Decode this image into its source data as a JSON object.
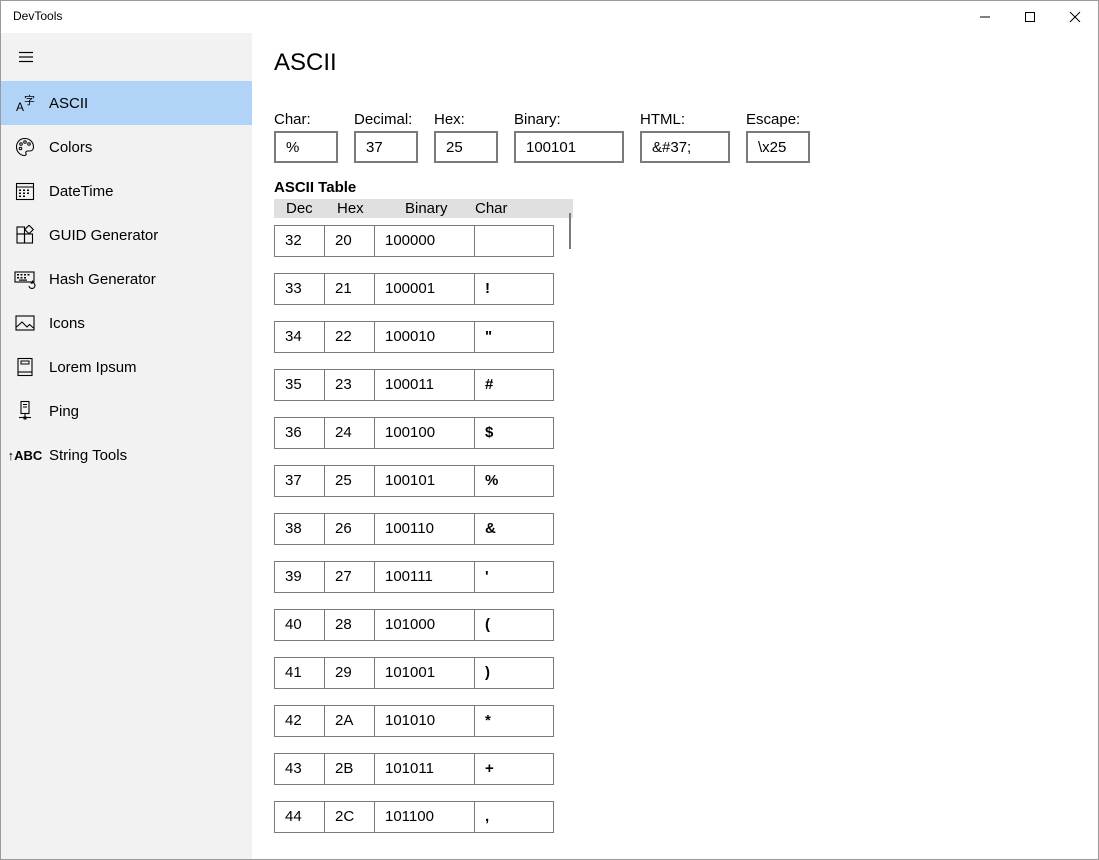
{
  "app": {
    "title": "DevTools"
  },
  "sidebar": {
    "items": [
      {
        "label": "ASCII",
        "icon": "ascii-icon",
        "selected": true
      },
      {
        "label": "Colors",
        "icon": "palette-icon"
      },
      {
        "label": "DateTime",
        "icon": "calendar-icon"
      },
      {
        "label": "GUID Generator",
        "icon": "guid-icon"
      },
      {
        "label": "Hash Generator",
        "icon": "keyboard-icon"
      },
      {
        "label": "Icons",
        "icon": "image-icon"
      },
      {
        "label": "Lorem Ipsum",
        "icon": "book-icon"
      },
      {
        "label": "Ping",
        "icon": "ping-icon"
      },
      {
        "label": "String Tools",
        "icon": "abc-icon",
        "icon_text": "↑ABC"
      }
    ]
  },
  "page": {
    "title": "ASCII",
    "fields": {
      "char": {
        "label": "Char:",
        "value": "%"
      },
      "decimal": {
        "label": "Decimal:",
        "value": "37"
      },
      "hex": {
        "label": "Hex:",
        "value": "25"
      },
      "binary": {
        "label": "Binary:",
        "value": "100101"
      },
      "html": {
        "label": "HTML:",
        "value": "&#37;"
      },
      "escape": {
        "label": "Escape:",
        "value": "\\x25"
      }
    },
    "table": {
      "title": "ASCII Table",
      "headers": {
        "dec": "Dec",
        "hex": "Hex",
        "binary": "Binary",
        "char": "Char"
      },
      "rows": [
        {
          "dec": "32",
          "hex": "20",
          "binary": "100000",
          "char": ""
        },
        {
          "dec": "33",
          "hex": "21",
          "binary": "100001",
          "char": "!"
        },
        {
          "dec": "34",
          "hex": "22",
          "binary": "100010",
          "char": "\""
        },
        {
          "dec": "35",
          "hex": "23",
          "binary": "100011",
          "char": "#"
        },
        {
          "dec": "36",
          "hex": "24",
          "binary": "100100",
          "char": "$"
        },
        {
          "dec": "37",
          "hex": "25",
          "binary": "100101",
          "char": "%"
        },
        {
          "dec": "38",
          "hex": "26",
          "binary": "100110",
          "char": "&"
        },
        {
          "dec": "39",
          "hex": "27",
          "binary": "100111",
          "char": "'"
        },
        {
          "dec": "40",
          "hex": "28",
          "binary": "101000",
          "char": "("
        },
        {
          "dec": "41",
          "hex": "29",
          "binary": "101001",
          "char": ")"
        },
        {
          "dec": "42",
          "hex": "2A",
          "binary": "101010",
          "char": "*"
        },
        {
          "dec": "43",
          "hex": "2B",
          "binary": "101011",
          "char": "+"
        },
        {
          "dec": "44",
          "hex": "2C",
          "binary": "101100",
          "char": ","
        }
      ]
    }
  },
  "colors": {
    "selected_bg": "#b0d3f7",
    "sidebar_bg": "#f2f2f2",
    "border": "#7a7a7a"
  }
}
